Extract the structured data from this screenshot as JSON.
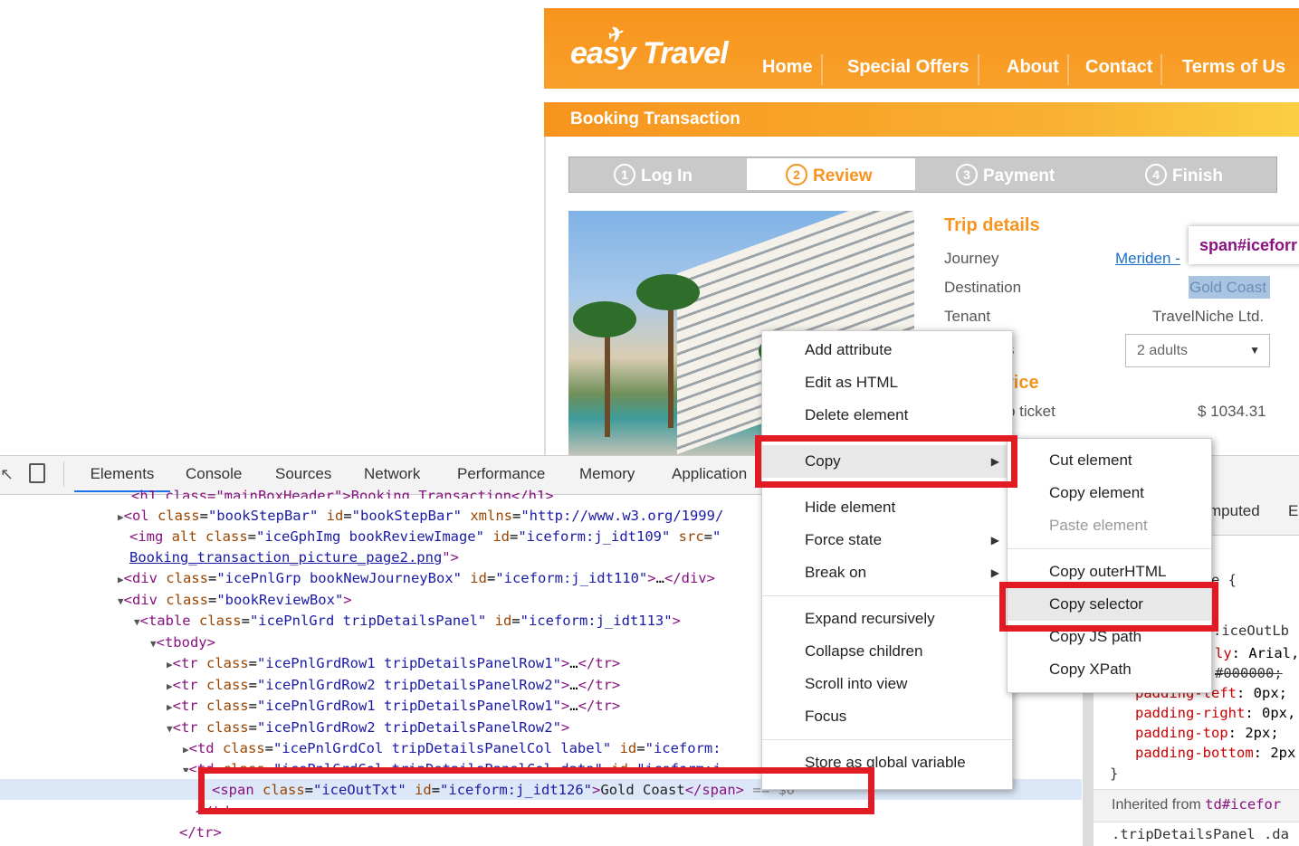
{
  "site": {
    "logo": "easy Travel",
    "nav": [
      "Home",
      "Special Offers",
      "About",
      "Contact",
      "Terms of Us"
    ],
    "booking_title": "Booking Transaction",
    "steps": [
      {
        "num": "1",
        "label": "Log In"
      },
      {
        "num": "2",
        "label": "Review"
      },
      {
        "num": "3",
        "label": "Payment"
      },
      {
        "num": "4",
        "label": "Finish"
      }
    ],
    "trip_heading": "Trip details",
    "journey_label": "Journey",
    "journey_value": "Meriden -",
    "destination_label": "Destination",
    "destination_value": "Gold Coast",
    "tenant_label": "Tenant",
    "tenant_value": "TravelNiche Ltd.",
    "travellers_partial": "s",
    "travellers_value": "2 adults",
    "price_heading_partial": "rice",
    "ticket_label_partial": "p ticket",
    "ticket_value": "$ 1034.31",
    "tooltip": "span#iceforr"
  },
  "devtools": {
    "tabs": [
      "Elements",
      "Console",
      "Sources",
      "Network",
      "Performance",
      "Memory",
      "Application"
    ],
    "styles": {
      "computed_tab": "mputed",
      "event_tab": "E",
      "rule_partial": "e {",
      "selector_partial": ".iceOutLb",
      "props": [
        {
          "name": "ly",
          "value": "Arial,"
        },
        {
          "name": "",
          "value": "#000000;"
        },
        {
          "name": "padding-left",
          "value": "0px;"
        },
        {
          "name": "padding-right",
          "value": "0px,"
        },
        {
          "name": "padding-top",
          "value": "2px;"
        },
        {
          "name": "padding-bottom",
          "value": "2px"
        }
      ],
      "close_brace": "}",
      "inherited": "Inherited from",
      "inherited_el": "td#icefor",
      "next_rule": ".tripDetailsPanel .da"
    }
  },
  "context_menu": {
    "items": [
      "Add attribute",
      "Edit as HTML",
      "Delete element",
      "Copy",
      "Hide element",
      "Force state",
      "Break on",
      "Expand recursively",
      "Collapse children",
      "Scroll into view",
      "Focus",
      "Store as global variable"
    ],
    "copy_submenu": [
      "Cut element",
      "Copy element",
      "Paste element",
      "Copy outerHTML",
      "Copy selector",
      "Copy JS path",
      "Copy XPath"
    ]
  }
}
